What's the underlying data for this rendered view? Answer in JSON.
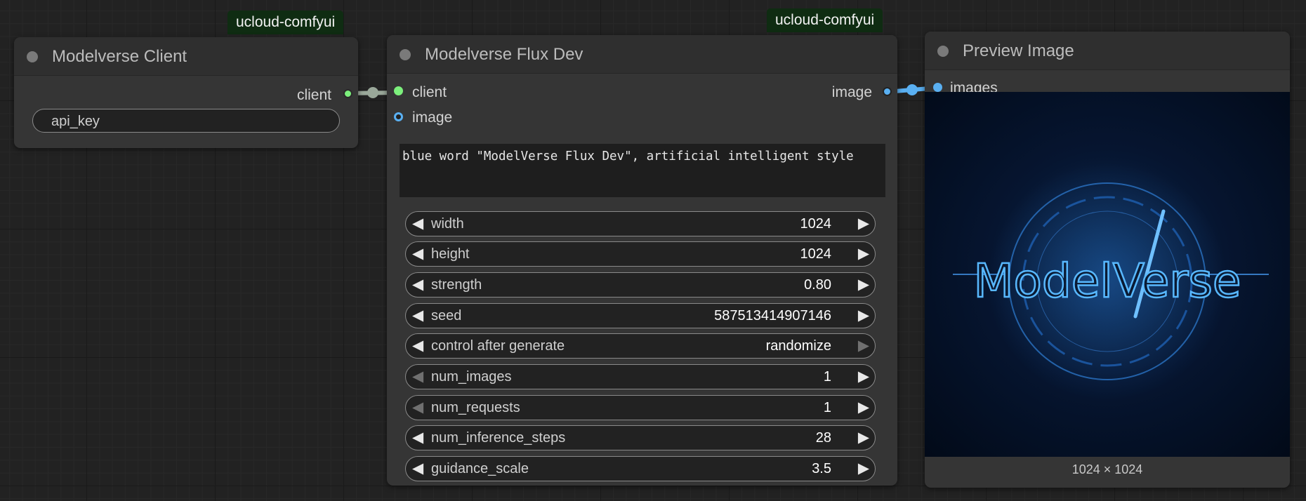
{
  "colors": {
    "client_slot": "#7cf07c",
    "image_slot": "#5ab0f2",
    "badge_bg": "#0f2c12",
    "node_bg": "#353535"
  },
  "badges": {
    "badge_1": "ucloud-comfyui",
    "badge_2": "ucloud-comfyui"
  },
  "client_node": {
    "title": "Modelverse Client",
    "output_client": "client",
    "api_key_placeholder": "api_key"
  },
  "flux_node": {
    "title": "Modelverse Flux Dev",
    "input_client": "client",
    "input_image": "image",
    "output_image": "image",
    "prompt": "blue word \"ModelVerse Flux Dev\", artificial intelligent style",
    "widgets": [
      {
        "label": "width",
        "value": "1024"
      },
      {
        "label": "height",
        "value": "1024"
      },
      {
        "label": "strength",
        "value": "0.80"
      },
      {
        "label": "seed",
        "value": "587513414907146"
      },
      {
        "label": "control after generate",
        "value": "randomize"
      },
      {
        "label": "num_images",
        "value": "1"
      },
      {
        "label": "num_requests",
        "value": "1"
      },
      {
        "label": "num_inference_steps",
        "value": "28"
      },
      {
        "label": "guidance_scale",
        "value": "3.5"
      }
    ]
  },
  "preview_node": {
    "title": "Preview Image",
    "input_images": "images",
    "image_text": "ModelVerse",
    "dimensions": "1024 × 1024"
  }
}
